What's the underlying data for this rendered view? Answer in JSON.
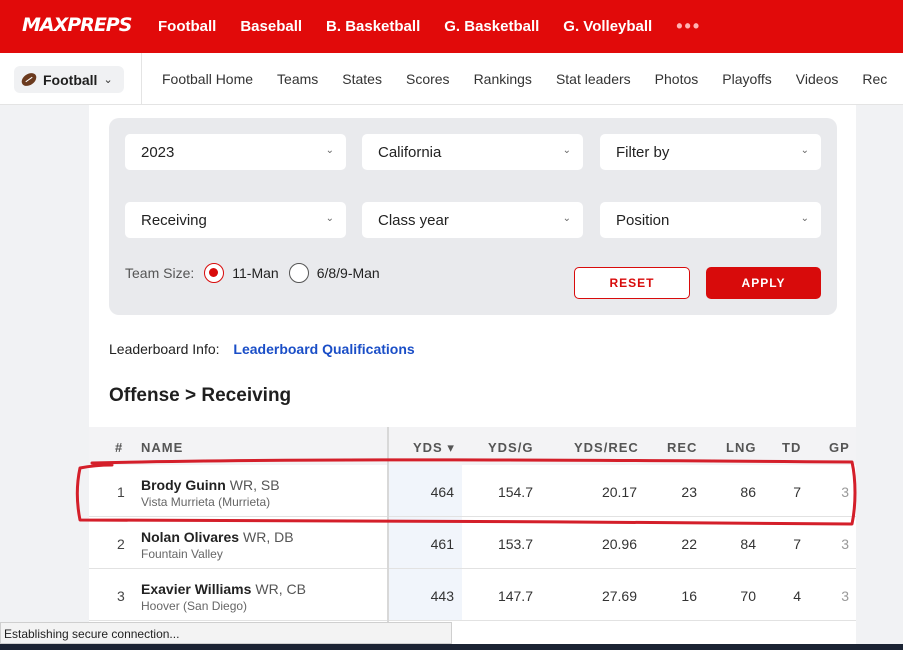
{
  "colors": {
    "brand": "#e10a0a",
    "accent_red": "#d80b0b",
    "link": "#1a4ec7",
    "annotation": "#d41f2a"
  },
  "brand": {
    "logo": "MAXPREPS"
  },
  "topnav": {
    "items": [
      "Football",
      "Baseball",
      "B. Basketball",
      "G. Basketball",
      "G. Volleyball"
    ],
    "more": "•••"
  },
  "subnav": {
    "sport": "Football",
    "items": [
      "Football Home",
      "Teams",
      "States",
      "Scores",
      "Rankings",
      "Stat leaders",
      "Photos",
      "Playoffs",
      "Videos",
      "Rec"
    ]
  },
  "filters": {
    "year": "2023",
    "state": "California",
    "filter_by": "Filter by",
    "category": "Receiving",
    "class_year": "Class year",
    "position": "Position",
    "team_size_label": "Team Size:",
    "team_size_options": [
      "11-Man",
      "6/8/9-Man"
    ],
    "team_size_selected": "11-Man",
    "reset": "RESET",
    "apply": "APPLY"
  },
  "leaderboard_info": {
    "label": "Leaderboard Info:",
    "link": "Leaderboard Qualifications"
  },
  "section_title": "Offense > Receiving",
  "table": {
    "headers": {
      "rank": "#",
      "name": "NAME",
      "yds": "YDS ▾",
      "yds_g": "YDS/G",
      "yds_rec": "YDS/REC",
      "rec": "REC",
      "lng": "LNG",
      "td": "TD",
      "gp": "GP"
    },
    "rows": [
      {
        "rank": "1",
        "name": "Brody Guinn",
        "pos": "WR, SB",
        "school": "Vista Murrieta (Murrieta)",
        "yds": "464",
        "yds_g": "154.7",
        "yds_rec": "20.17",
        "rec": "23",
        "lng": "86",
        "td": "7",
        "gp": "3"
      },
      {
        "rank": "2",
        "name": "Nolan Olivares",
        "pos": "WR, DB",
        "school": "Fountain Valley",
        "yds": "461",
        "yds_g": "153.7",
        "yds_rec": "20.96",
        "rec": "22",
        "lng": "84",
        "td": "7",
        "gp": "3"
      },
      {
        "rank": "3",
        "name": "Exavier Williams",
        "pos": "WR, CB",
        "school": "Hoover (San Diego)",
        "yds": "443",
        "yds_g": "147.7",
        "yds_rec": "27.69",
        "rec": "16",
        "lng": "70",
        "td": "4",
        "gp": "3"
      }
    ]
  },
  "status_bar": "Establishing secure connection..."
}
